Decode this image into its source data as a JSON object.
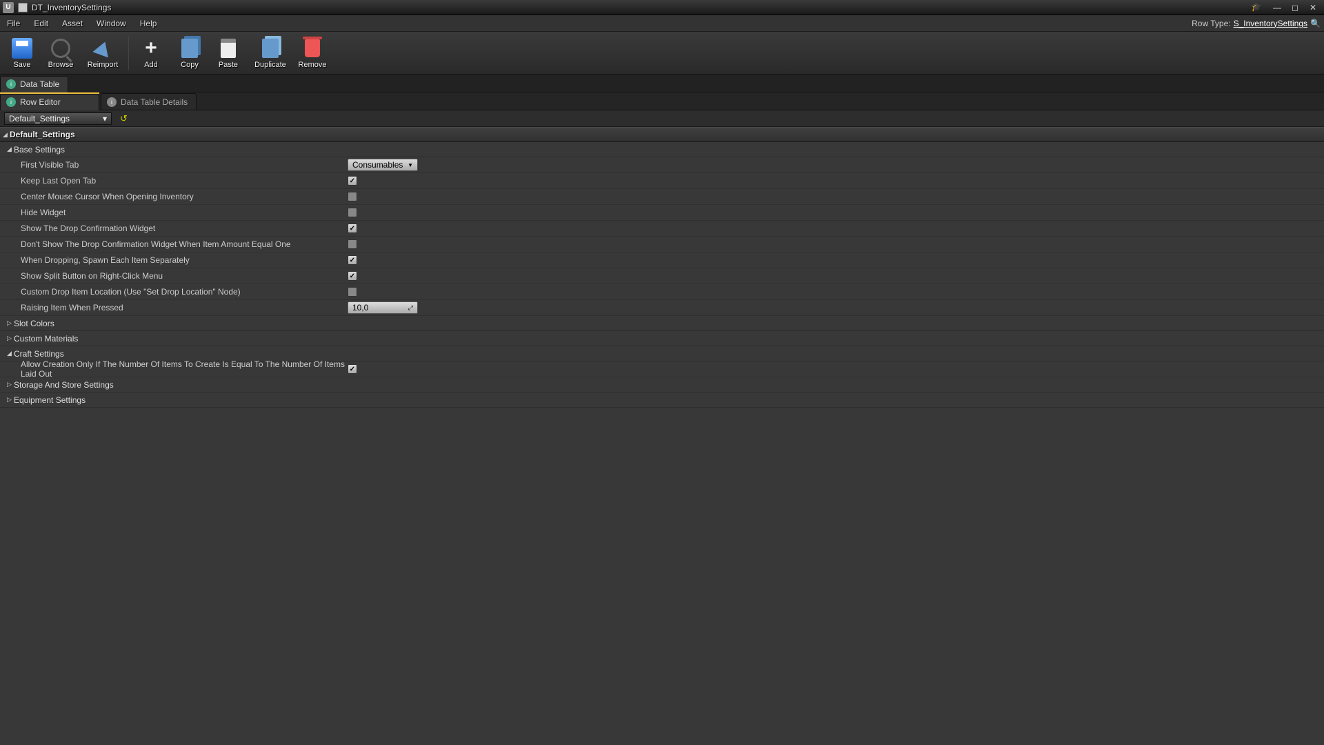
{
  "titlebar": {
    "title": "DT_InventorySettings"
  },
  "menu": {
    "items": [
      "File",
      "Edit",
      "Asset",
      "Window",
      "Help"
    ],
    "row_type_label": "Row Type:",
    "row_type_value": "S_InventorySettings"
  },
  "toolbar": {
    "save": "Save",
    "browse": "Browse",
    "reimport": "Reimport",
    "add": "Add",
    "copy": "Copy",
    "paste": "Paste",
    "duplicate": "Duplicate",
    "remove": "Remove"
  },
  "tabs": {
    "data_table": "Data Table",
    "row_editor": "Row Editor",
    "data_table_details": "Data Table Details"
  },
  "row_select": {
    "value": "Default_Settings"
  },
  "section_header": "Default_Settings",
  "categories": {
    "base": "Base Settings",
    "slot_colors": "Slot Colors",
    "custom_materials": "Custom Materials",
    "craft": "Craft Settings",
    "storage": "Storage And Store Settings",
    "equipment": "Equipment Settings"
  },
  "props": {
    "first_visible_tab": {
      "label": "First Visible Tab",
      "value": "Consumables"
    },
    "keep_last_open_tab": {
      "label": "Keep Last Open Tab",
      "checked": true
    },
    "center_mouse": {
      "label": "Center Mouse Cursor When Opening Inventory",
      "checked": false
    },
    "hide_widget": {
      "label": "Hide Widget",
      "checked": false
    },
    "show_drop_confirm": {
      "label": "Show The Drop Confirmation Widget",
      "checked": true
    },
    "dont_show_drop_confirm_one": {
      "label": "Don't Show The Drop Confirmation Widget When Item Amount Equal One",
      "checked": false
    },
    "spawn_separately": {
      "label": "When Dropping, Spawn Each Item Separately",
      "checked": true
    },
    "show_split_rmb": {
      "label": "Show Split Button on Right-Click Menu",
      "checked": true
    },
    "custom_drop_loc": {
      "label": "Custom Drop Item Location (Use \"Set Drop Location\" Node)",
      "checked": false
    },
    "raising_item": {
      "label": "Raising Item When Pressed",
      "value": "10,0"
    },
    "allow_creation": {
      "label": "Allow Creation Only If The Number Of Items To Create Is Equal To The Number Of Items Laid Out",
      "checked": true
    }
  }
}
